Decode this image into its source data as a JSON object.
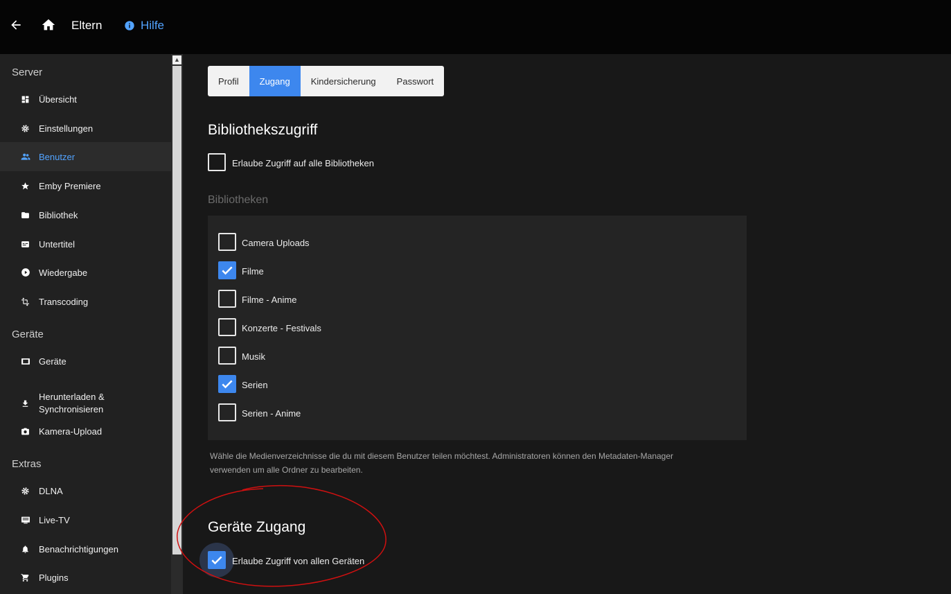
{
  "header": {
    "back_icon": "arrow-left-icon",
    "home_icon": "home-icon",
    "title": "Eltern",
    "help_label": "Hilfe",
    "help_icon": "info-icon",
    "accent_color": "#52a3ff"
  },
  "sidebar": {
    "sections": [
      {
        "label": "Server",
        "items": [
          {
            "label": "Übersicht",
            "icon": "dashboard-icon"
          },
          {
            "label": "Einstellungen",
            "icon": "gear-icon"
          },
          {
            "label": "Benutzer",
            "icon": "people-icon",
            "active": true
          },
          {
            "label": "Emby Premiere",
            "icon": "star-icon"
          },
          {
            "label": "Bibliothek",
            "icon": "folder-icon"
          },
          {
            "label": "Untertitel",
            "icon": "subtitles-icon"
          },
          {
            "label": "Wiedergabe",
            "icon": "play-circle-icon"
          },
          {
            "label": "Transcoding",
            "icon": "transform-icon"
          }
        ]
      },
      {
        "label": "Geräte",
        "items": [
          {
            "label": "Geräte",
            "icon": "tablet-icon"
          },
          {
            "label_line1": "Herunterladen &",
            "label_line2": "Synchronisieren",
            "icon": "download-icon"
          },
          {
            "label": "Kamera-Upload",
            "icon": "camera-icon"
          }
        ]
      },
      {
        "label": "Extras",
        "items": [
          {
            "label": "DLNA",
            "icon": "gear-icon"
          },
          {
            "label": "Live-TV",
            "icon": "tv-icon"
          },
          {
            "label": "Benachrichtigungen",
            "icon": "bell-icon"
          },
          {
            "label": "Plugins",
            "icon": "cart-icon"
          }
        ]
      }
    ]
  },
  "tabs": [
    {
      "label": "Profil",
      "active": false
    },
    {
      "label": "Zugang",
      "active": true
    },
    {
      "label": "Kindersicherung",
      "active": false
    },
    {
      "label": "Passwort",
      "active": false
    }
  ],
  "library_access": {
    "title": "Bibliothekszugriff",
    "all_label": "Erlaube Zugriff auf alle Bibliotheken",
    "all_checked": false,
    "libraries_heading": "Bibliotheken",
    "libraries": [
      {
        "label": "Camera Uploads",
        "checked": false
      },
      {
        "label": "Filme",
        "checked": true
      },
      {
        "label": "Filme - Anime",
        "checked": false
      },
      {
        "label": "Konzerte - Festivals",
        "checked": false
      },
      {
        "label": "Musik",
        "checked": false
      },
      {
        "label": "Serien",
        "checked": true
      },
      {
        "label": "Serien - Anime",
        "checked": false
      }
    ],
    "note_line1": "Wähle die Medienverzeichnisse die du mit diesem Benutzer teilen möchtest. Administratoren können den Metadaten-Manager",
    "note_line2": "verwenden um alle Ordner zu bearbeiten."
  },
  "device_access": {
    "title": "Geräte Zugang",
    "all_label": "Erlaube Zugriff von allen Geräten",
    "all_checked": true
  },
  "colors": {
    "checkbox_checked": "#3d87ee",
    "annotation": "#d01010"
  }
}
